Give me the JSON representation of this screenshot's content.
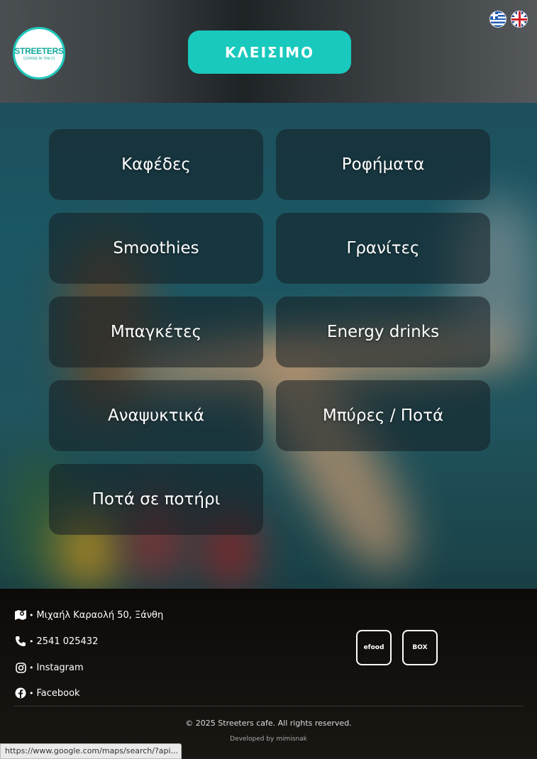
{
  "header": {
    "logo_text": "STREETERS",
    "logo_subtext": "COFFEE IN THE CI",
    "close_label": "ΚΛΕΙΣΙΜΟ",
    "languages": [
      "greek-flag-icon",
      "uk-flag-icon"
    ]
  },
  "categories": [
    "Καφέδες",
    "Ροφήματα",
    "Smoothies",
    "Γρανίτες",
    "Μπαγκέτες",
    "Energy drinks",
    "Αναψυκτικά",
    "Μπύρες / Ποτά",
    "Ποτά σε ποτήρι"
  ],
  "footer": {
    "address": "Μιχαήλ Καραολή 50, Ξάνθη",
    "phone": "2541 025432",
    "instagram": "Instagram",
    "facebook": "Facebook",
    "partners": [
      "efood",
      "BOX"
    ],
    "copyright": "© 2025 Streeters cafe. All rights reserved.",
    "developed_by": "Developed by mimisnak"
  },
  "status_bar": {
    "url": "https://www.google.com/maps/search/?api..."
  },
  "colors": {
    "accent": "#19c9bd",
    "footer_bg": "#14110e"
  }
}
